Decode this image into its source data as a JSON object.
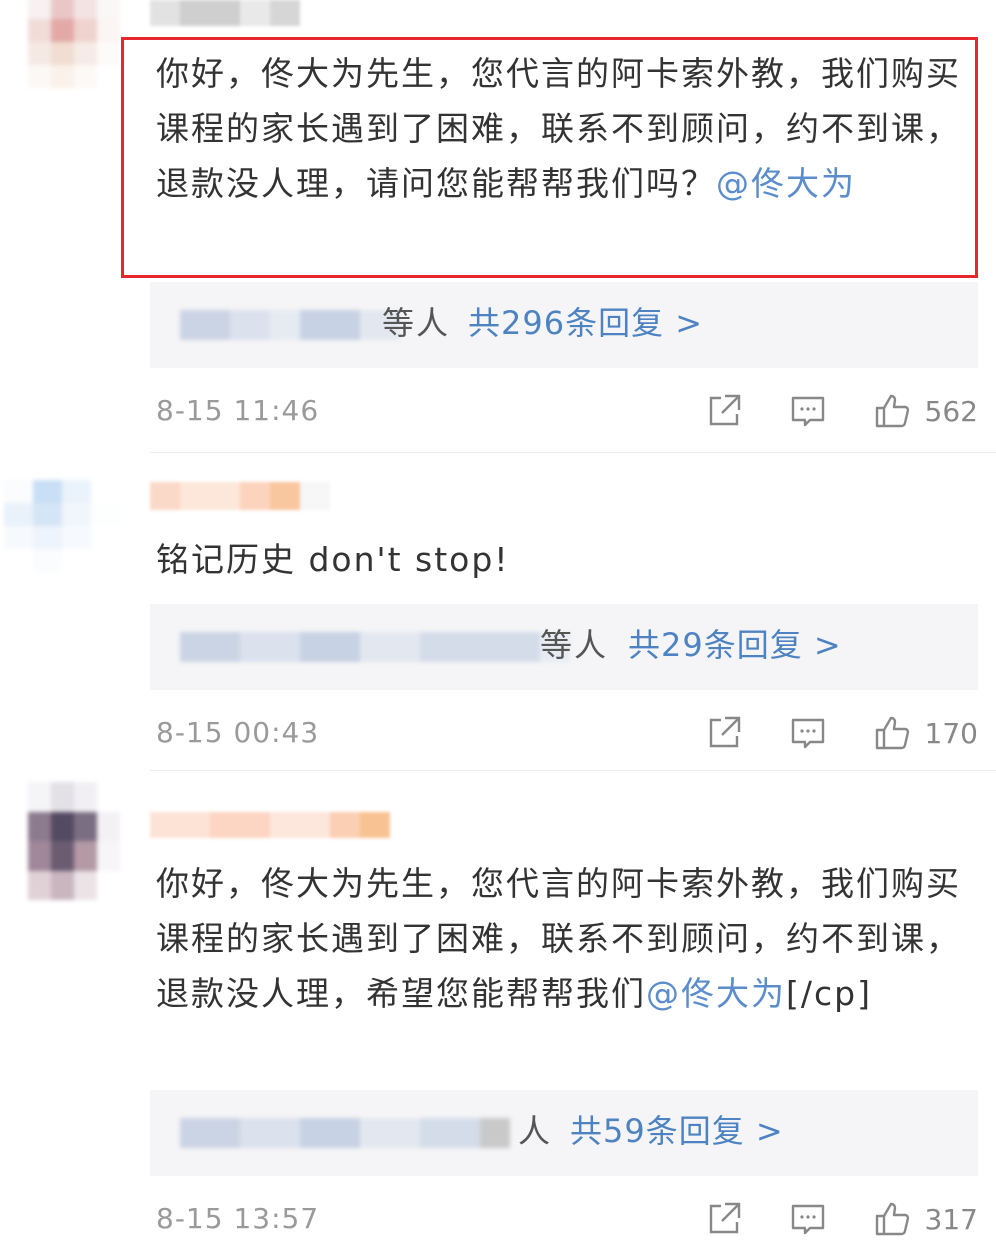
{
  "comments": [
    {
      "text_before": "你好，佟大为先生，您代言的阿卡索外教，我们购买课程的家长遇到了困难，联系不到顾问，约不到课，退款没人理，请问您能帮帮我们吗？",
      "mention": "@佟大为",
      "text_after": "",
      "reply_suffix": "等人",
      "reply_link": "共296条回复 >",
      "timestamp": "8-15 11:46",
      "likes": "562",
      "highlighted": true
    },
    {
      "text_before": "铭记历史 don't stop!",
      "mention": "",
      "text_after": "",
      "reply_suffix": "等人",
      "reply_link": "共29条回复 >",
      "timestamp": "8-15 00:43",
      "likes": "170",
      "highlighted": false
    },
    {
      "text_before": "你好，佟大为先生，您代言的阿卡索外教，我们购买课程的家长遇到了困难，联系不到顾问，约不到课，退款没人理，希望您能帮帮我们",
      "mention": "@佟大为",
      "text_after": "[/cp]",
      "reply_suffix": "人",
      "reply_link": "共59条回复 >",
      "timestamp": "8-15 13:57",
      "likes": "317",
      "highlighted": false
    }
  ],
  "icons": {
    "share": "share-icon",
    "comment": "comment-icon",
    "like": "thumbs-up-icon"
  },
  "colors": {
    "mention": "#5b8ccb",
    "highlight_border": "#e8262d",
    "reply_link": "#4e83c2"
  }
}
